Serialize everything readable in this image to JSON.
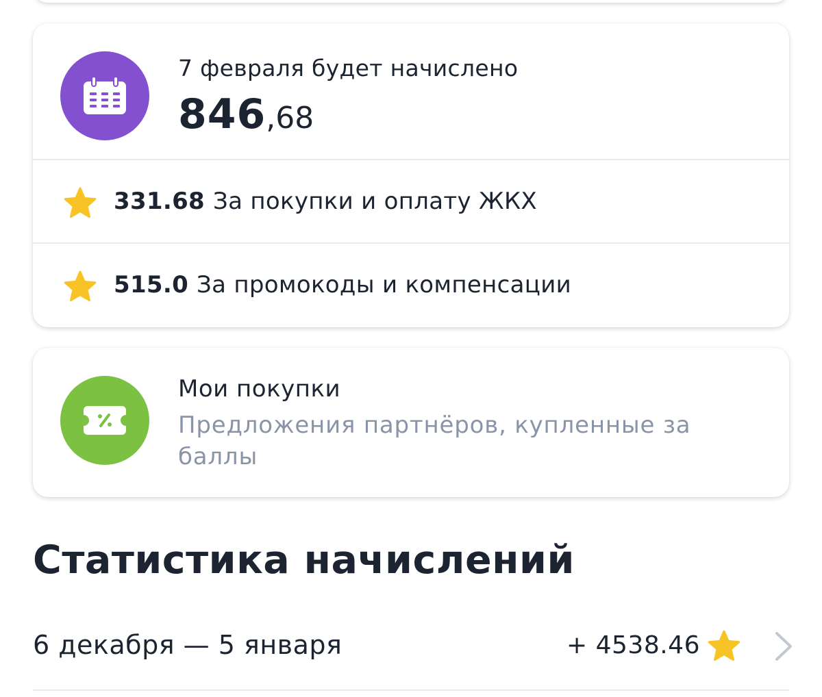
{
  "accrual_card": {
    "title": "7 февраля будет начислено",
    "amount_int": "846",
    "amount_frac": ",68",
    "icon": "calendar-icon",
    "icon_color": "#8350d0",
    "breakdown": [
      {
        "value": "331.68",
        "label": "За покупки и оплату ЖКХ",
        "icon": "star-icon"
      },
      {
        "value": "515.0",
        "label": "За промокоды и компенсации",
        "icon": "star-icon"
      }
    ]
  },
  "purchases_card": {
    "title": "Мои покупки",
    "subtitle": "Предложения партнёров, купленные за баллы",
    "icon": "coupon-icon",
    "icon_color": "#7cc142"
  },
  "statistics": {
    "title": "Статистика начислений",
    "rows": [
      {
        "period": "6 декабря — 5 января",
        "amount": "+ 4538.46",
        "icon": "star-icon"
      }
    ]
  },
  "colors": {
    "text_primary": "#1b2430",
    "text_secondary": "#8a94a8",
    "star": "#f7c325",
    "divider": "#e7e9ee"
  }
}
